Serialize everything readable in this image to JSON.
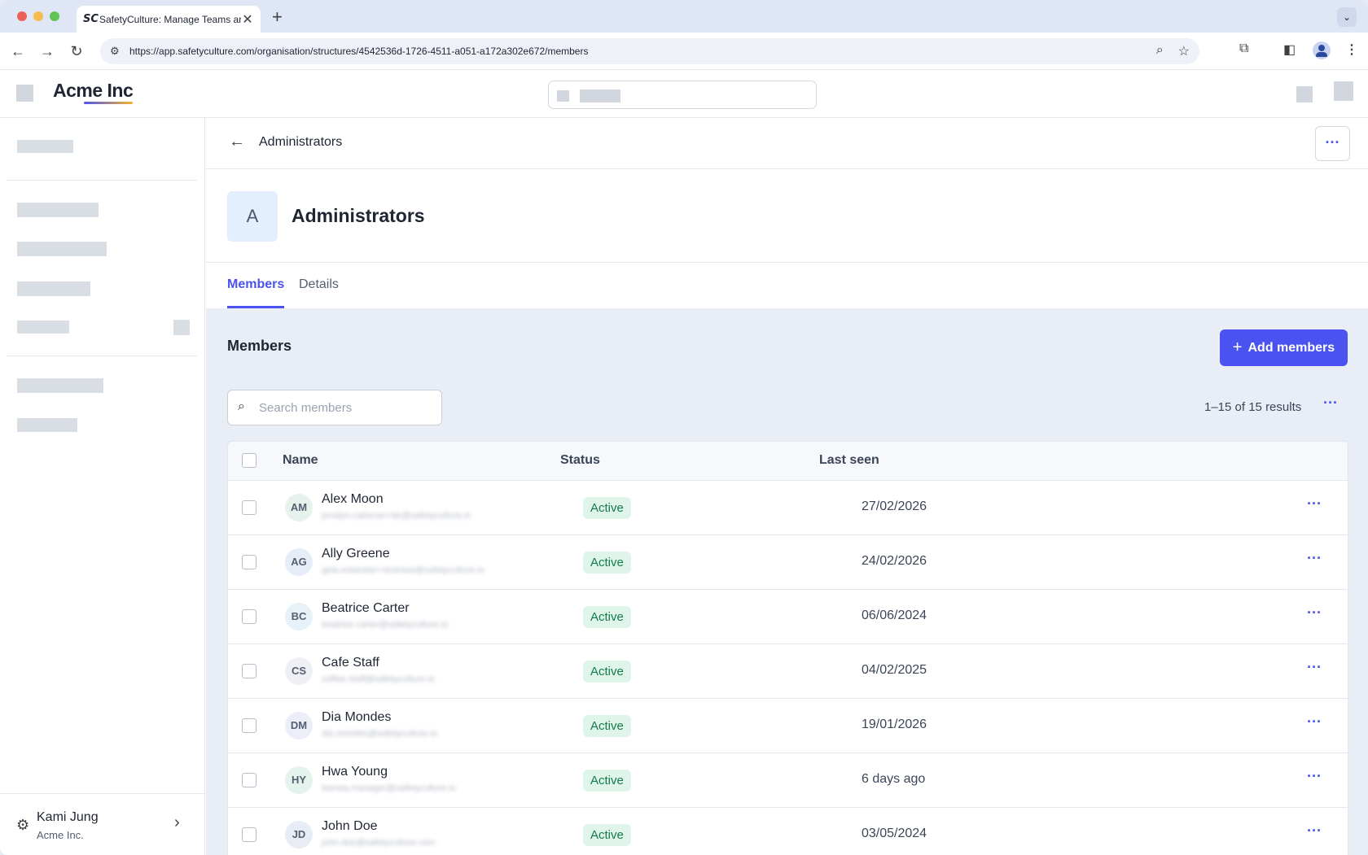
{
  "browser": {
    "tab_favicon": "SC",
    "tab_title": "SafetyCulture: Manage Teams and...",
    "url": "https://app.safetyculture.com/organisation/structures/4542536d-1726-4511-a051-a172a302e672/members"
  },
  "app": {
    "logo_text": "Acme Inc"
  },
  "sidebar": {
    "user_name": "Kami Jung",
    "user_org": "Acme Inc."
  },
  "page": {
    "topbar_title": "Administrators",
    "group_initial": "A",
    "group_name": "Administrators",
    "tabs": [
      {
        "label": "Members",
        "active": true
      },
      {
        "label": "Details",
        "active": false
      }
    ]
  },
  "members": {
    "section_title": "Members",
    "add_button": "Add members",
    "search_placeholder": "Search members",
    "results_text": "1–15 of 15 results",
    "columns": {
      "name": "Name",
      "status": "Status",
      "last_seen": "Last seen"
    },
    "rows": [
      {
        "initials": "AM",
        "name": "Alex Moon",
        "email": "jonalyn.cabocan+tte@safetyculture.io",
        "status": "Active",
        "last_seen": "27/02/2026",
        "avatar_color": "#e6f2ec"
      },
      {
        "initials": "AG",
        "name": "Ally Greene",
        "email": "gela.estandarr+testnew@safetyculture.io",
        "status": "Active",
        "last_seen": "24/02/2026",
        "avatar_color": "#e6edf7"
      },
      {
        "initials": "BC",
        "name": "Beatrice Carter",
        "email": "beatrice.carter@safetyculture.io",
        "status": "Active",
        "last_seen": "06/06/2024",
        "avatar_color": "#e6f1f8"
      },
      {
        "initials": "CS",
        "name": "Cafe Staff",
        "email": "coffee.staff@safetyculture.io",
        "status": "Active",
        "last_seen": "04/02/2025",
        "avatar_color": "#eef0f4"
      },
      {
        "initials": "DM",
        "name": "Dia Mondes",
        "email": "dia.mondes@safetyculture.io",
        "status": "Active",
        "last_seen": "19/01/2026",
        "avatar_color": "#eceef8"
      },
      {
        "initials": "HY",
        "name": "Hwa Young",
        "email": "barista.manager@safetyculture.io",
        "status": "Active",
        "last_seen": "6 days ago",
        "avatar_color": "#e4f4ec"
      },
      {
        "initials": "JD",
        "name": "John Doe",
        "email": "john.doe@safetyculture.com",
        "status": "Active",
        "last_seen": "03/05/2024",
        "avatar_color": "#e8edf5"
      }
    ]
  },
  "icons": {
    "back": "arrow-left-icon",
    "more": "ellipsis-icon",
    "search": "search-icon",
    "settings": "gear-icon",
    "chevron": "chevron-right-icon"
  },
  "colors": {
    "accent": "#4a52f0",
    "status_active_bg": "#dff5ea",
    "status_active_text": "#157a4c"
  }
}
